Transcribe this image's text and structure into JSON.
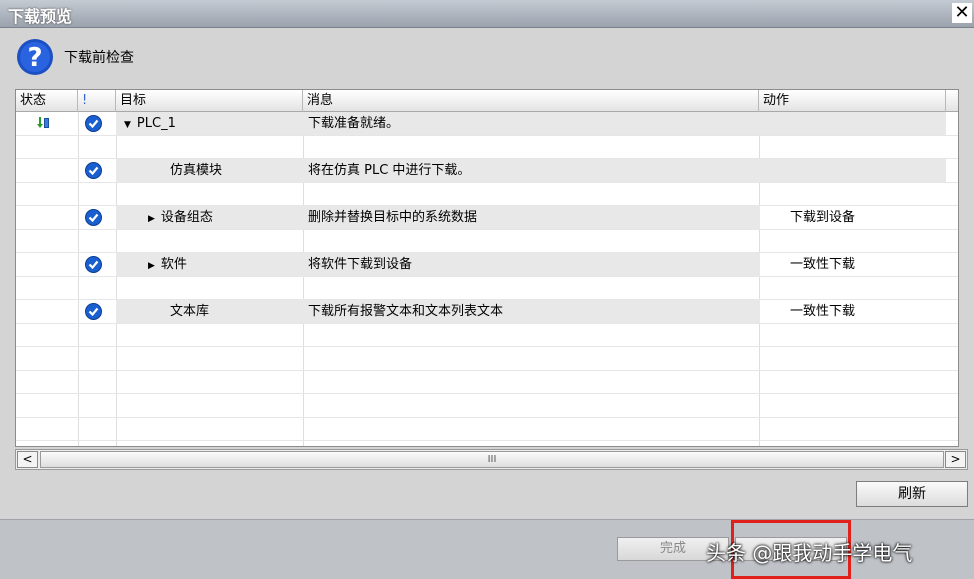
{
  "window": {
    "title": "下载预览",
    "close_symbol": "✕"
  },
  "header": {
    "label": "下载前检查"
  },
  "columns": [
    "状态",
    "!",
    "目标",
    "消息",
    "动作"
  ],
  "rows": [
    {
      "status_icon": "download-icon",
      "check": true,
      "expand": "down",
      "target": "PLC_1",
      "message": "下载准备就绪。",
      "action": "",
      "indent": 0
    },
    {
      "check": false,
      "target": "",
      "message": "",
      "action": ""
    },
    {
      "check": true,
      "expand": "",
      "target": "仿真模块",
      "message": "将在仿真 PLC 中进行下载。",
      "action": "",
      "indent": 2
    },
    {
      "check": false,
      "target": "",
      "message": "",
      "action": ""
    },
    {
      "check": true,
      "expand": "right",
      "target": "设备组态",
      "message": "删除并替换目标中的系统数据",
      "action": "下载到设备",
      "indent": 1
    },
    {
      "check": false,
      "target": "",
      "message": "",
      "action": ""
    },
    {
      "check": true,
      "expand": "right",
      "target": "软件",
      "message": "将软件下载到设备",
      "action": "一致性下载",
      "indent": 1
    },
    {
      "check": false,
      "target": "",
      "message": "",
      "action": ""
    },
    {
      "check": true,
      "expand": "",
      "target": "文本库",
      "message": "下载所有报警文本和文本列表文本",
      "action": "一致性下载",
      "indent": 2
    }
  ],
  "scrollbar": {
    "left": "<",
    "right": ">",
    "thumb_grip": "III"
  },
  "buttons": {
    "refresh": "刷新",
    "finish": "完成"
  },
  "watermark": "头条 @跟我动手学电气",
  "colors": {
    "check_blue": "#1a5fd0",
    "highlight_red": "#e0201a",
    "help_blue": "#1c4fc4"
  }
}
